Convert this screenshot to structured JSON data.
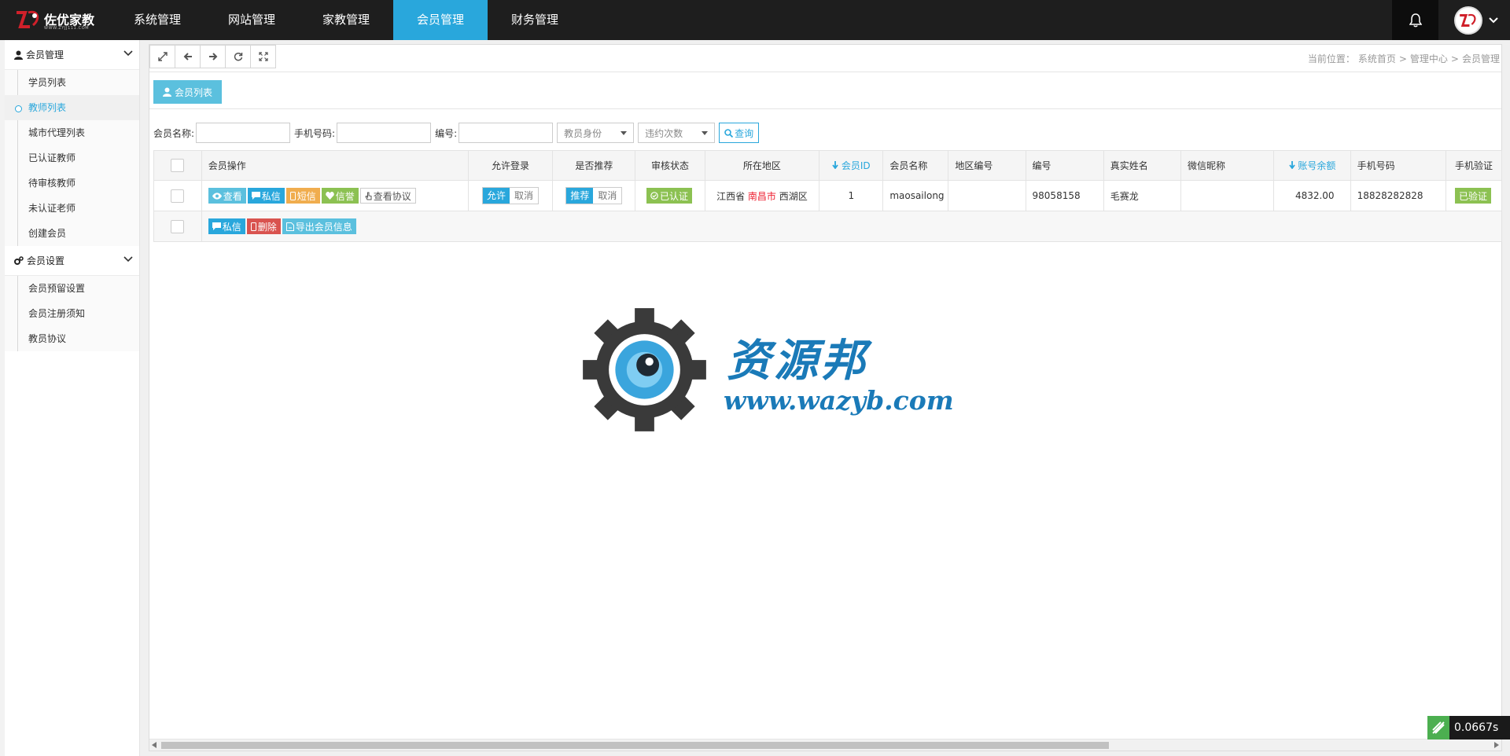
{
  "brand": {
    "name": "佐优家教",
    "sub": "WWW.ZYJJ111.COM"
  },
  "nav": [
    {
      "label": "系统管理",
      "active": false
    },
    {
      "label": "网站管理",
      "active": false
    },
    {
      "label": "家教管理",
      "active": false
    },
    {
      "label": "会员管理",
      "active": true
    },
    {
      "label": "财务管理",
      "active": false
    }
  ],
  "sidebar": {
    "groups": [
      {
        "title": "会员管理",
        "items": [
          "学员列表",
          "教师列表",
          "城市代理列表",
          "已认证教师",
          "待审核教师",
          "未认证老师",
          "创建会员"
        ],
        "active_index": 1
      },
      {
        "title": "会员设置",
        "items": [
          "会员预留设置",
          "会员注册须知",
          "教员协议"
        ]
      }
    ]
  },
  "breadcrumb": {
    "prefix": "当前位置：",
    "items": [
      "系统首页",
      "管理中心",
      "会员管理"
    ]
  },
  "tab": {
    "label": "会员列表"
  },
  "filter": {
    "name_label": "会员名称:",
    "phone_label": "手机号码:",
    "code_label": "编号:",
    "identity_select": "教员身份",
    "violation_select": "违约次数",
    "search_label": "查询"
  },
  "table": {
    "headers": [
      "会员操作",
      "允许登录",
      "是否推荐",
      "审核状态",
      "所在地区",
      "会员ID",
      "会员名称",
      "地区编号",
      "编号",
      "真实姓名",
      "微信昵称",
      "账号余额",
      "手机号码",
      "手机验证"
    ],
    "row_actions": {
      "view": "查看",
      "message": "私信",
      "sms": "短信",
      "credit": "信誉",
      "agreement": "查看协议"
    },
    "login": {
      "allow": "允许",
      "cancel": "取消"
    },
    "recommend": {
      "on": "推荐",
      "cancel": "取消"
    },
    "rows": [
      {
        "status": "已认证",
        "province": "江西省",
        "city": "南昌市",
        "district": "西湖区",
        "id": "1",
        "username": "maosailong",
        "area_code": "",
        "code": "98058158",
        "real_name": "毛赛龙",
        "wechat": "",
        "balance": "4832.00",
        "phone": "18828282828",
        "phone_verify": "已验证"
      }
    ],
    "bulk": {
      "message": "私信",
      "delete": "删除",
      "export": "导出会员信息"
    }
  },
  "watermark": {
    "text": "资源邦",
    "url": "www.wazyb.com"
  },
  "timer": "0.0667s",
  "colors": {
    "accent": "#29a7dc",
    "topbar": "#1e1e1e",
    "warn": "#f0ad4e",
    "success": "#8cc152",
    "danger": "#d9534f"
  }
}
